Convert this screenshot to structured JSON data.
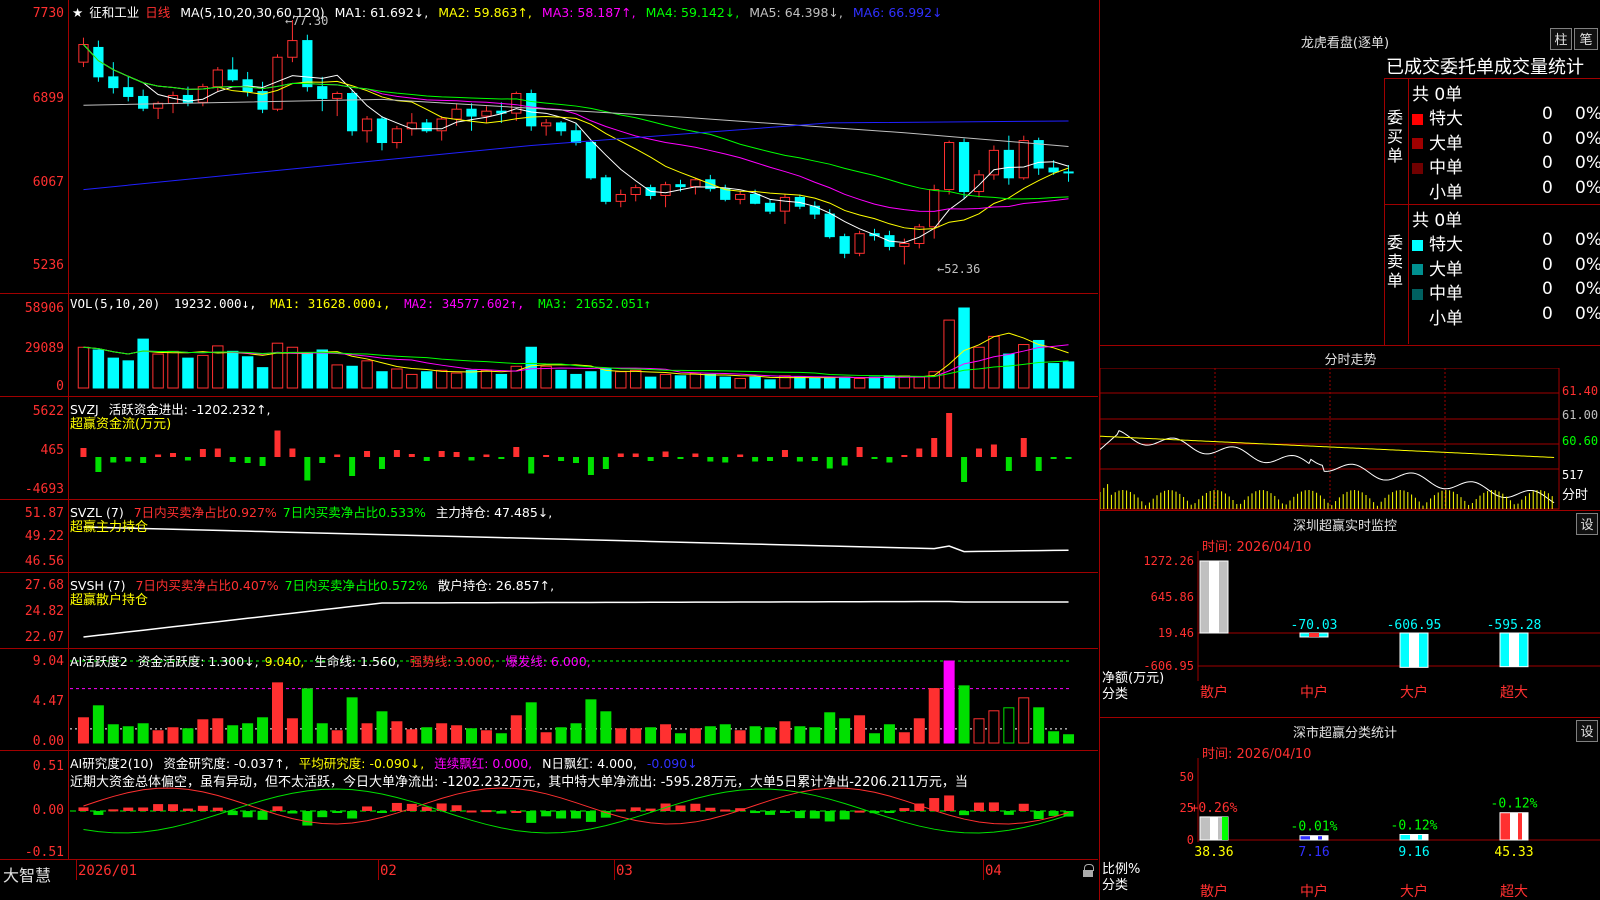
{
  "stock": {
    "name": "征和工业",
    "period": "日线",
    "star": "★"
  },
  "colors": {
    "up": "#ff3030",
    "down": "#00ffff",
    "grid": "#a00000",
    "ma1": "#ffffff",
    "ma2": "#ffff00",
    "ma3": "#ff00ff",
    "ma4": "#00ff00",
    "ma5": "#a0a0a0",
    "ma6": "#0000ff"
  },
  "kline": {
    "ma_label": "MA(5,10,20,30,60,120)",
    "ma": [
      {
        "label": "MA1: 61.692↓,",
        "color": "#ffffff"
      },
      {
        "label": "MA2: 59.863↑,",
        "color": "#ffff00"
      },
      {
        "label": "MA3: 58.187↑,",
        "color": "#ff00ff"
      },
      {
        "label": "MA4: 59.142↓,",
        "color": "#00ff00"
      },
      {
        "label": "MA5: 64.398↓,",
        "color": "#c0c0c0"
      },
      {
        "label": "MA6: 66.992↓",
        "color": "#3030ff"
      }
    ],
    "axis": [
      "7730",
      "6899",
      "6067",
      "5236"
    ],
    "high_label": "77.30",
    "low_label": "52.36"
  },
  "vol": {
    "label": "VOL(5,10,20)",
    "value": "19232.000↓,",
    "ma1": "MA1: 31628.000↓,",
    "ma2": "MA2: 34577.602↑,",
    "ma3": "MA3: 21652.051↑",
    "axis": [
      "58906",
      "29089",
      "0"
    ]
  },
  "svzj": {
    "label": "SVZJ",
    "desc": "活跃资金进出: -1202.232↑,",
    "sub": "超赢资金流(万元)",
    "axis": [
      "5622",
      "465",
      "-4693"
    ]
  },
  "svzl": {
    "label": "SVZL (7)",
    "a": "7日内买卖净占比0.927%",
    "b": "7日内买卖净占比0.533%",
    "c": "主力持仓: 47.485↓,",
    "sub": "超赢主力持仓",
    "axis": [
      "51.87",
      "49.22",
      "46.56"
    ]
  },
  "svsh": {
    "label": "SVSH (7)",
    "a": "7日内买卖净占比0.407%",
    "b": "7日内买卖净占比0.572%",
    "c": "散户持仓: 26.857↑,",
    "sub": "超赢散户持仓",
    "axis": [
      "27.68",
      "24.82",
      "22.07"
    ]
  },
  "ai1": {
    "label": "AI活跃度2",
    "a": "资金活跃度: 1.300↓,",
    "b": "9.040,",
    "c": "生命线: 1.560,",
    "d": "强势线: 3.000,",
    "e": "爆发线: 6.000,",
    "axis": [
      "9.04",
      "4.47",
      "0.00"
    ]
  },
  "ai2": {
    "label": "AI研究度2(10)",
    "a": "资金研究度: -0.037↑,",
    "b": "平均研究度: -0.090↓,",
    "c": "连续飘红: 0.000,",
    "d": "N日飘红: 4.000,",
    "e": "-0.090↓",
    "note": "近期大资金总体偏空，虽有异动，但不太活跃，今日大单净流出: -1202.232万元，其中特大单净流出: -595.28万元，大单5日累计净出-2206.211万元，当",
    "axis": [
      "0.51",
      "0.00",
      "-0.51"
    ]
  },
  "dates": [
    "2026/01",
    "02",
    "03",
    "04"
  ],
  "brand": "大智慧",
  "right": {
    "lhb_title": "龙虎看盘(逐单)",
    "btn1": "柱",
    "btn2": "笔",
    "stat_title": "已成交委托单成交量统计",
    "buy": {
      "side": "委买单",
      "total": "共 0单",
      "rows": [
        {
          "name": "特大",
          "v": "0",
          "p": "0%",
          "c": "#ff0000"
        },
        {
          "name": "大单",
          "v": "0",
          "p": "0%",
          "c": "#a00000"
        },
        {
          "name": "中单",
          "v": "0",
          "p": "0%",
          "c": "#700000"
        },
        {
          "name": "小单",
          "v": "0",
          "p": "0%",
          "c": "#000000"
        }
      ]
    },
    "sell": {
      "side": "委卖单",
      "total": "共 0单",
      "rows": [
        {
          "name": "特大",
          "v": "0",
          "p": "0%",
          "c": "#00ffff"
        },
        {
          "name": "大单",
          "v": "0",
          "p": "0%",
          "c": "#009090"
        },
        {
          "name": "中单",
          "v": "0",
          "p": "0%",
          "c": "#006060"
        },
        {
          "name": "小单",
          "v": "0",
          "p": "0%",
          "c": "#000000"
        }
      ]
    },
    "fs": {
      "title": "分时走势",
      "axis": [
        "61.40",
        "61.00",
        "60.60"
      ],
      "vol_label": "517",
      "vol_sub": "分时"
    },
    "monitor": {
      "title": "深圳超赢实时监控",
      "btn": "设",
      "time": "时间: 2026/04/10",
      "axis": [
        "1272.26",
        "645.86",
        "19.46",
        "-606.95"
      ],
      "top_label": "1272.26",
      "bars": [
        {
          "cat": "散户",
          "val": "1272.26"
        },
        {
          "cat": "中户",
          "val": "-70.03"
        },
        {
          "cat": "大户",
          "val": "-606.95"
        },
        {
          "cat": "超大",
          "val": "-595.28"
        }
      ],
      "unit": "净额(万元)",
      "unit2": "分类"
    },
    "cls": {
      "title": "深市超赢分类统计",
      "btn": "设",
      "time": "时间: 2026/04/10",
      "axis": [
        "75",
        "50",
        "25",
        "0"
      ],
      "bars": [
        {
          "cat": "散户",
          "val": "38.36",
          "chg": "+0.26%"
        },
        {
          "cat": "中户",
          "val": "7.16",
          "chg": "-0.01%"
        },
        {
          "cat": "大户",
          "val": "9.16",
          "chg": "-0.12%"
        },
        {
          "cat": "超大",
          "val": "45.33",
          "chg": "-0.12%"
        }
      ],
      "unit": "比例%",
      "unit2": "分类"
    }
  },
  "chart_data": {
    "type": "candlestick",
    "title": "征和工业 日线",
    "candles_ohlc": [
      [
        73.0,
        75.5,
        72.5,
        74.8
      ],
      [
        74.5,
        75.2,
        71.0,
        71.5
      ],
      [
        71.5,
        73.0,
        69.8,
        70.4
      ],
      [
        70.4,
        71.5,
        69.0,
        69.5
      ],
      [
        69.5,
        70.2,
        68.0,
        68.3
      ],
      [
        68.3,
        69.0,
        67.2,
        68.8
      ],
      [
        68.8,
        70.0,
        67.8,
        69.6
      ],
      [
        69.6,
        70.5,
        68.5,
        68.9
      ],
      [
        68.9,
        70.8,
        68.5,
        70.5
      ],
      [
        70.5,
        72.5,
        70.0,
        72.2
      ],
      [
        72.2,
        73.5,
        71.0,
        71.2
      ],
      [
        71.2,
        72.0,
        69.5,
        70.0
      ],
      [
        70.0,
        71.0,
        67.8,
        68.2
      ],
      [
        68.2,
        73.8,
        68.0,
        73.5
      ],
      [
        73.5,
        77.3,
        73.0,
        75.2
      ],
      [
        75.2,
        75.8,
        70.0,
        70.5
      ],
      [
        70.5,
        71.5,
        68.0,
        69.3
      ],
      [
        69.3,
        70.0,
        67.5,
        69.8
      ],
      [
        69.8,
        70.2,
        65.5,
        66.0
      ],
      [
        66.0,
        67.5,
        64.8,
        67.2
      ],
      [
        67.2,
        67.5,
        64.0,
        64.8
      ],
      [
        64.8,
        66.5,
        64.2,
        66.2
      ],
      [
        66.2,
        67.8,
        65.5,
        66.8
      ],
      [
        66.8,
        67.2,
        65.8,
        66.0
      ],
      [
        66.0,
        67.5,
        65.0,
        67.2
      ],
      [
        67.2,
        68.8,
        66.5,
        68.2
      ],
      [
        68.2,
        68.8,
        66.0,
        67.5
      ],
      [
        67.5,
        68.5,
        66.8,
        68.0
      ],
      [
        68.0,
        68.9,
        66.8,
        67.8
      ],
      [
        67.8,
        70.0,
        67.0,
        69.8
      ],
      [
        69.8,
        70.2,
        66.0,
        66.5
      ],
      [
        66.5,
        67.2,
        65.5,
        66.8
      ],
      [
        66.8,
        67.0,
        65.5,
        66.0
      ],
      [
        66.0,
        66.8,
        64.5,
        64.8
      ],
      [
        64.8,
        65.0,
        61.0,
        61.2
      ],
      [
        61.2,
        61.5,
        58.5,
        58.8
      ],
      [
        58.8,
        60.0,
        58.2,
        59.5
      ],
      [
        59.5,
        60.5,
        58.8,
        60.2
      ],
      [
        60.2,
        60.5,
        59.0,
        59.4
      ],
      [
        59.4,
        60.8,
        58.2,
        60.5
      ],
      [
        60.5,
        61.0,
        59.8,
        60.3
      ],
      [
        60.3,
        61.2,
        59.5,
        61.0
      ],
      [
        61.0,
        61.5,
        59.8,
        60.1
      ],
      [
        60.1,
        60.5,
        58.8,
        59.0
      ],
      [
        59.0,
        59.8,
        58.5,
        59.5
      ],
      [
        59.5,
        60.0,
        58.5,
        58.6
      ],
      [
        58.6,
        59.0,
        57.5,
        57.8
      ],
      [
        57.8,
        59.5,
        56.5,
        59.2
      ],
      [
        59.2,
        59.5,
        58.0,
        58.3
      ],
      [
        58.3,
        58.8,
        57.0,
        57.5
      ],
      [
        57.5,
        58.0,
        55.0,
        55.2
      ],
      [
        55.2,
        55.5,
        53.0,
        53.5
      ],
      [
        53.5,
        55.8,
        53.2,
        55.5
      ],
      [
        55.5,
        56.0,
        54.8,
        55.3
      ],
      [
        55.3,
        55.8,
        53.8,
        54.2
      ],
      [
        54.2,
        55.0,
        52.36,
        54.5
      ],
      [
        54.5,
        56.5,
        54.0,
        56.2
      ],
      [
        56.2,
        60.5,
        55.0,
        60.0
      ],
      [
        60.0,
        65.0,
        59.5,
        64.8
      ],
      [
        64.8,
        65.2,
        59.0,
        59.8
      ],
      [
        59.8,
        62.0,
        59.2,
        61.5
      ],
      [
        61.5,
        64.5,
        61.0,
        64.0
      ],
      [
        64.0,
        65.5,
        60.5,
        61.2
      ],
      [
        61.2,
        65.5,
        61.0,
        65.0
      ],
      [
        65.0,
        65.3,
        61.5,
        62.2
      ],
      [
        62.2,
        63.0,
        61.5,
        61.8
      ],
      [
        61.8,
        62.5,
        60.8,
        61.7
      ]
    ],
    "volume": [
      30000,
      28000,
      22000,
      20000,
      36000,
      25000,
      27000,
      22000,
      24000,
      31000,
      27000,
      23000,
      15000,
      33000,
      30000,
      26000,
      28000,
      17000,
      16000,
      20000,
      12000,
      14000,
      10000,
      12000,
      13000,
      11000,
      13000,
      13000,
      10000,
      16000,
      30000,
      16000,
      13000,
      10000,
      12000,
      14000,
      12000,
      13000,
      8000,
      10000,
      9000,
      11000,
      10000,
      8000,
      7000,
      8000,
      6000,
      9000,
      8000,
      7000,
      8000,
      8000,
      7000,
      8000,
      9000,
      9000,
      8000,
      12000,
      50000,
      58906,
      30000,
      38000,
      25000,
      32000,
      35000,
      18000,
      19232
    ]
  }
}
